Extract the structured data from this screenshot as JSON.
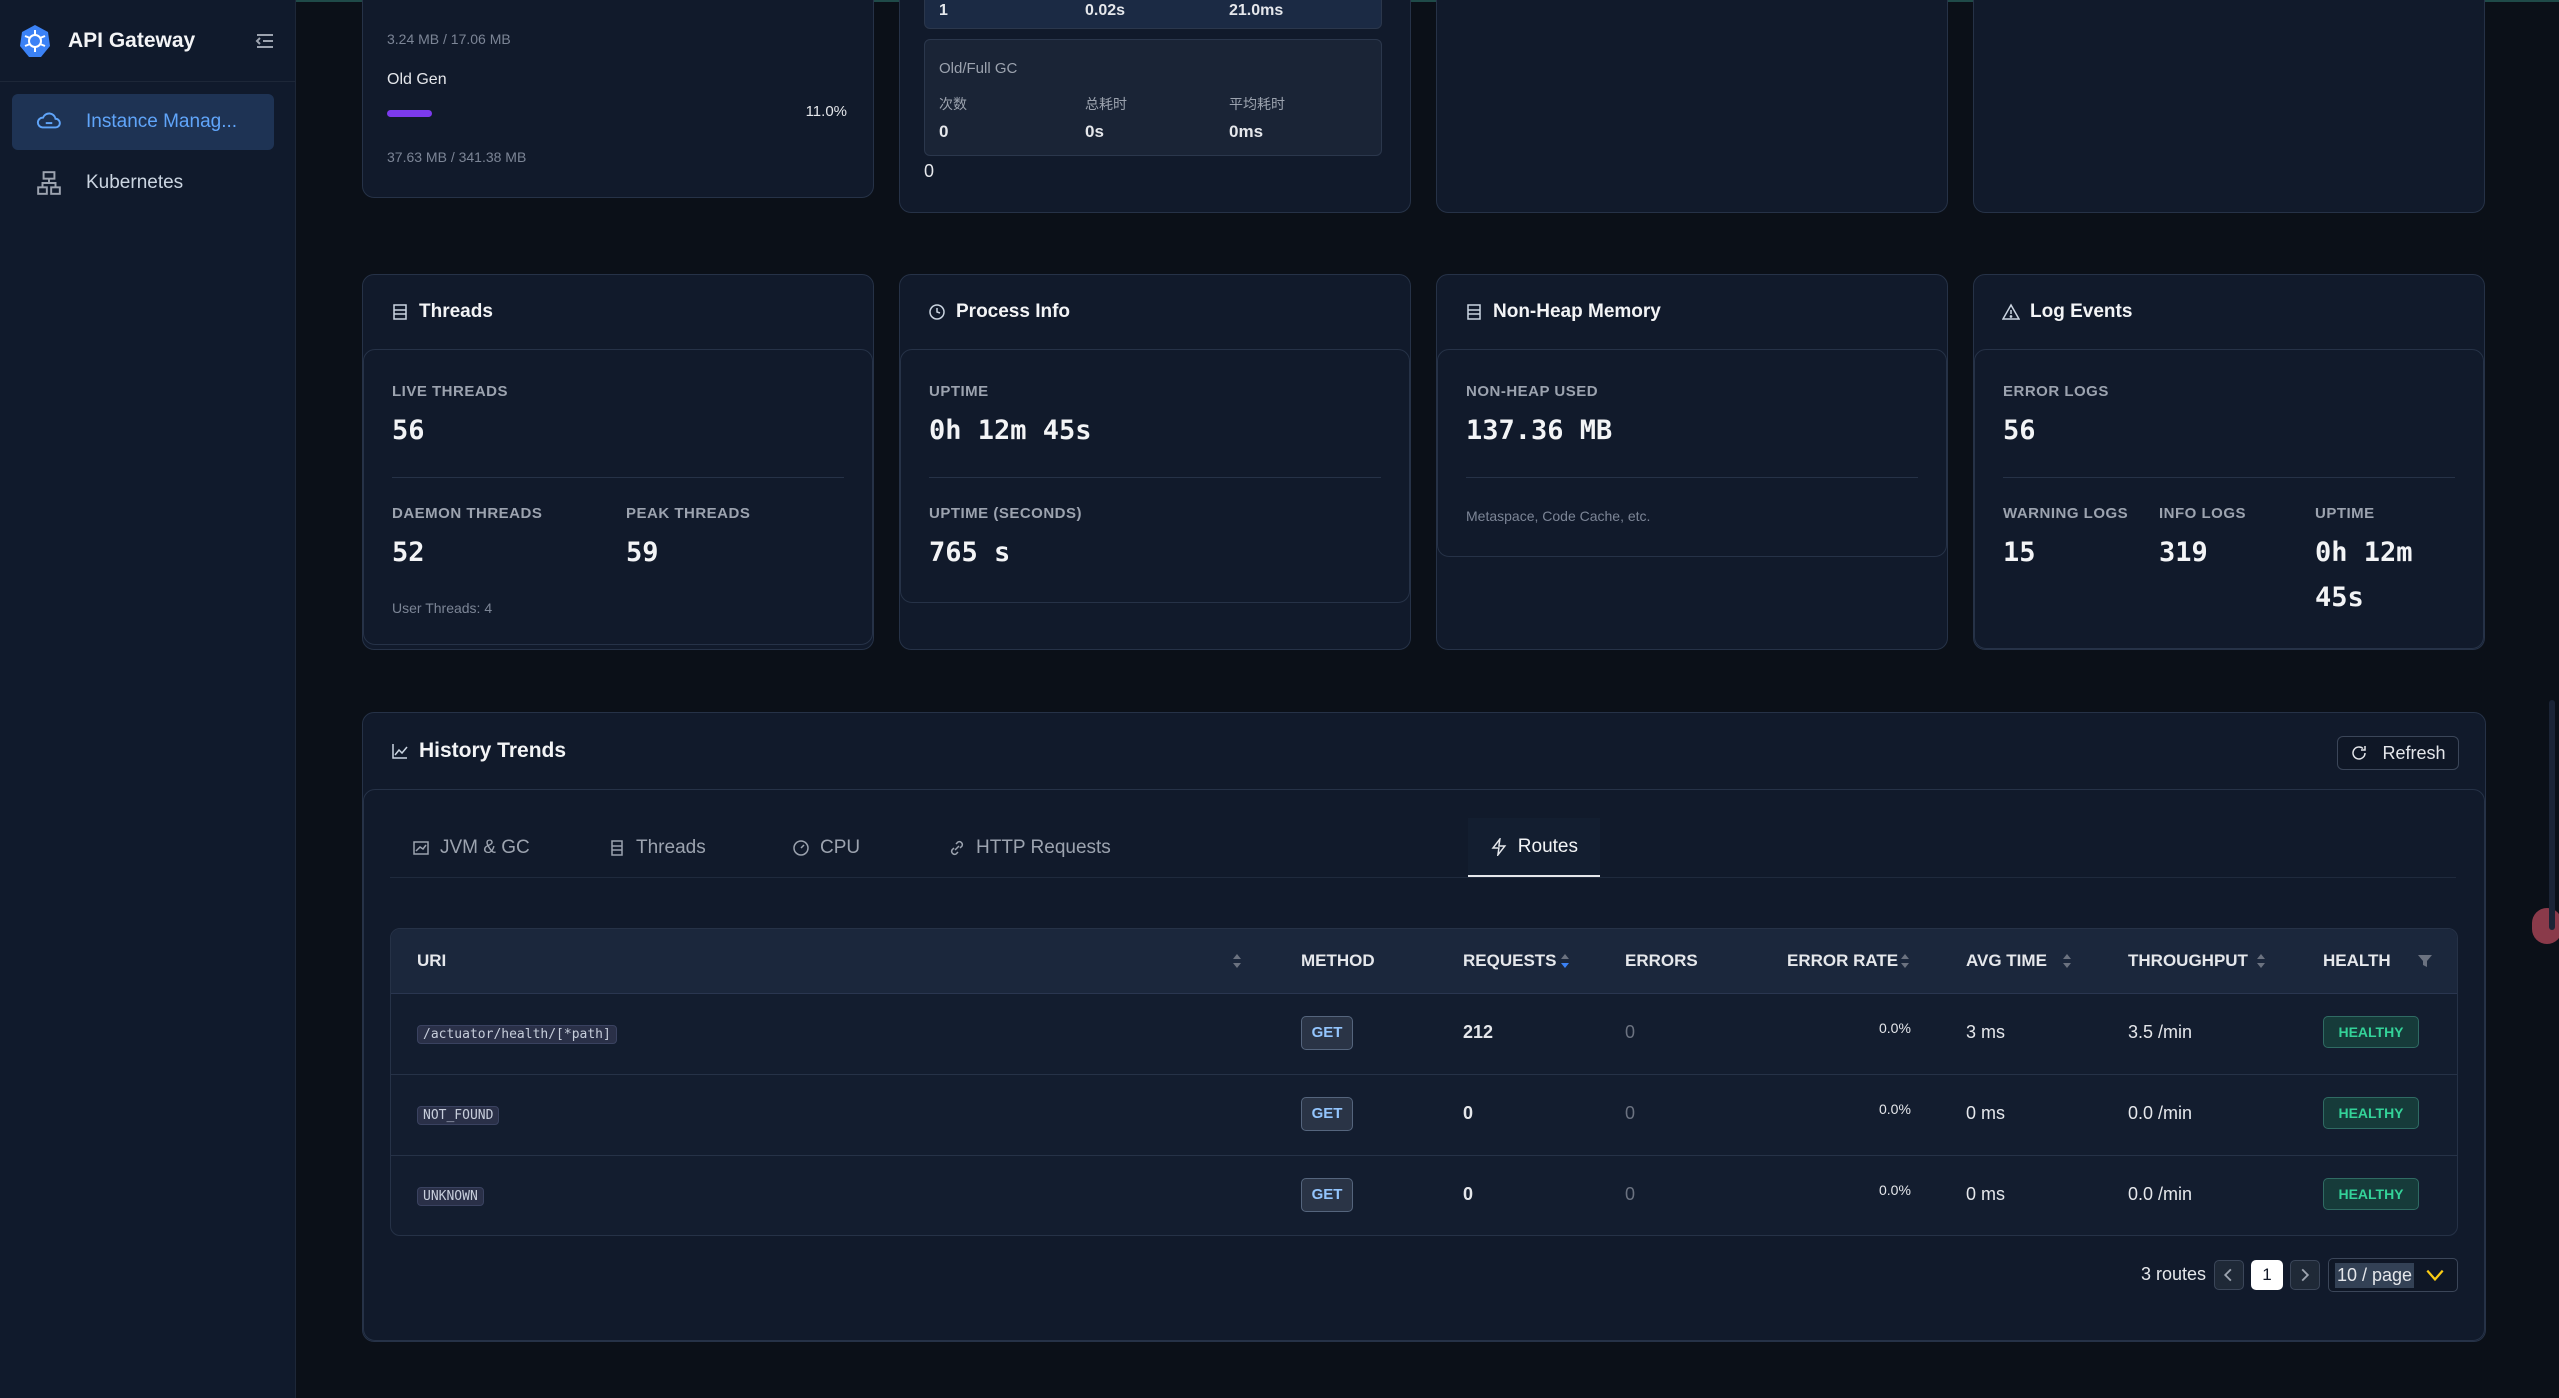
{
  "app": {
    "title": "API Gateway"
  },
  "sidebar": {
    "items": [
      {
        "label": "Instance Manag..."
      },
      {
        "label": "Kubernetes"
      }
    ]
  },
  "memory_card": {
    "used_line": "3.24 MB / 17.06 MB",
    "old_gen_label": "Old Gen",
    "old_gen_pct": "11.0%",
    "old_gen_fraction": 0.11,
    "old_gen_used": "37.63 MB / 341.38 MB"
  },
  "gc_card": {
    "young_row": [
      "1",
      "0.02s",
      "21.0ms"
    ],
    "old_title": "Old/Full GC",
    "cols": [
      "次数",
      "总耗时",
      "平均耗时"
    ],
    "old_vals": [
      "0",
      "0s",
      "0ms"
    ],
    "footer": "0"
  },
  "threads": {
    "title": "Threads",
    "live_label": "LIVE THREADS",
    "live": "56",
    "daemon_label": "DAEMON THREADS",
    "daemon": "52",
    "peak_label": "PEAK THREADS",
    "peak": "59",
    "user": "User Threads: 4"
  },
  "process": {
    "title": "Process Info",
    "uptime_label": "UPTIME",
    "uptime": "0h 12m 45s",
    "uptime_sec_label": "UPTIME (SECONDS)",
    "uptime_sec": "765 s"
  },
  "nonheap": {
    "title": "Non-Heap Memory",
    "used_label": "NON-HEAP USED",
    "used": "137.36 MB",
    "note": "Metaspace, Code Cache, etc."
  },
  "logs": {
    "title": "Log Events",
    "error_label": "ERROR LOGS",
    "error": "56",
    "warn_label": "WARNING LOGS",
    "warn": "15",
    "info_label": "INFO LOGS",
    "info": "319",
    "uptime_label": "UPTIME",
    "uptime_l1": "0h 12m",
    "uptime_l2": "45s"
  },
  "history": {
    "title": "History Trends",
    "refresh": "Refresh",
    "tabs": [
      "JVM & GC",
      "Threads",
      "CPU",
      "HTTP Requests",
      "Routes"
    ],
    "active_tab": "Routes"
  },
  "routes_table": {
    "headers": [
      "URI",
      "METHOD",
      "REQUESTS",
      "ERRORS",
      "ERROR RATE",
      "AVG TIME",
      "THROUGHPUT",
      "HEALTH"
    ],
    "rows": [
      {
        "uri": "/actuator/health/[*path]",
        "method": "GET",
        "requests": "212",
        "errors": "0",
        "error_rate": "0.0%",
        "avg": "3 ms",
        "throughput": "3.5 /min",
        "health": "HEALTHY"
      },
      {
        "uri": "NOT_FOUND",
        "method": "GET",
        "requests": "0",
        "errors": "0",
        "error_rate": "0.0%",
        "avg": "0 ms",
        "throughput": "0.0 /min",
        "health": "HEALTHY"
      },
      {
        "uri": "UNKNOWN",
        "method": "GET",
        "requests": "0",
        "errors": "0",
        "error_rate": "0.0%",
        "avg": "0 ms",
        "throughput": "0.0 /min",
        "health": "HEALTHY"
      }
    ]
  },
  "pagination": {
    "total": "3 routes",
    "page": "1",
    "page_size": "10 / page"
  },
  "colors": {
    "accent": "#60a5fa",
    "healthy": "#34d399",
    "old_gen_bar": "#7c3aed"
  }
}
